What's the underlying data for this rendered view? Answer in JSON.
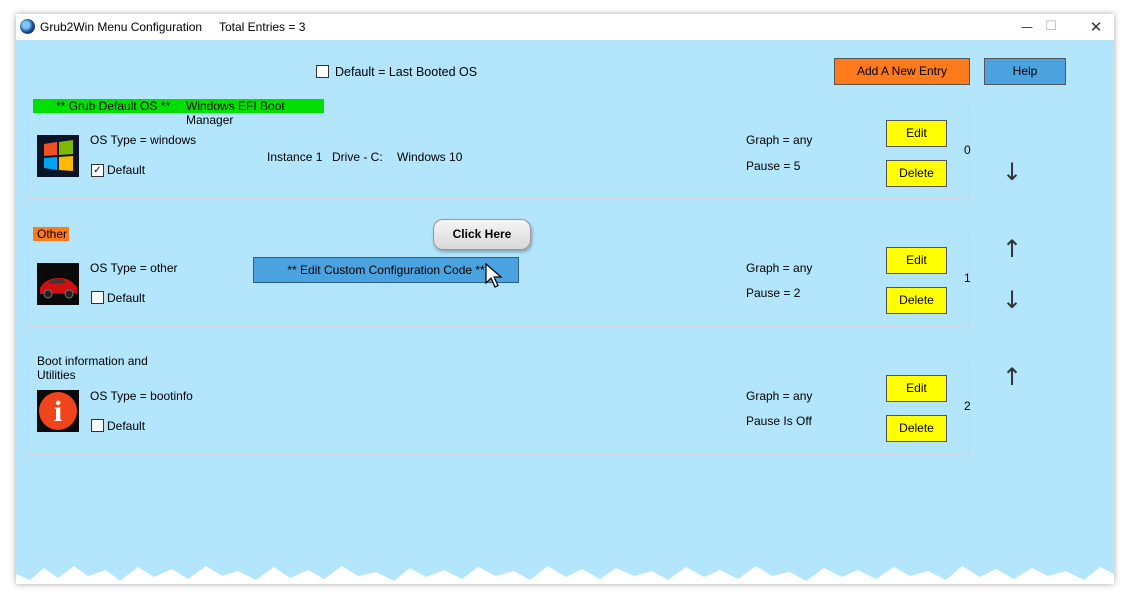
{
  "titlebar": {
    "title": "Grub2Win Menu Configuration",
    "total_entries": "Total Entries = 3",
    "minimize": "—",
    "maximize": "☐",
    "close": "✕"
  },
  "toolbar": {
    "default_last_booted_label": "Default = Last Booted OS",
    "default_last_booted_checked": false,
    "add_entry_label": "Add A New Entry",
    "help_label": "Help"
  },
  "entries": [
    {
      "header_left": "** Grub Default OS **",
      "header_right": "Windows EFI Boot Manager",
      "header_color": "#00e000",
      "icon": "windows-logo-icon",
      "os_type": "OS Type = windows",
      "default_label": "Default",
      "default_checked": true,
      "check_mark": "✓",
      "instance": "Instance 1",
      "drive": "Drive - C:",
      "version": "Windows 10",
      "graph": "Graph = any",
      "pause": "Pause = 5",
      "edit_label": "Edit",
      "delete_label": "Delete",
      "index": "0",
      "down_arrow": "↓"
    },
    {
      "header_left": "Other",
      "header_color": "#ff7a1a",
      "icon": "red-sports-car-icon",
      "os_type": "OS Type = other",
      "default_label": "Default",
      "default_checked": false,
      "custom_code_label": "**  Edit Custom Configuration Code  **",
      "graph": "Graph = any",
      "pause": "Pause = 2",
      "edit_label": "Edit",
      "delete_label": "Delete",
      "index": "1",
      "up_arrow": "↑",
      "down_arrow": "↓"
    },
    {
      "header_left": "Boot information and Utilities",
      "icon": "info-icon",
      "icon_glyph": "i",
      "os_type": "OS Type = bootinfo",
      "default_label": "Default",
      "default_checked": false,
      "graph": "Graph = any",
      "pause": "Pause Is Off",
      "edit_label": "Edit",
      "delete_label": "Delete",
      "index": "2",
      "up_arrow": "↑"
    }
  ],
  "tooltip": {
    "label": "Click Here"
  },
  "colors": {
    "background": "#b3e5fc",
    "button_yellow": "#ffff00",
    "button_orange": "#ff7a1a",
    "button_blue": "#4aa3df"
  }
}
